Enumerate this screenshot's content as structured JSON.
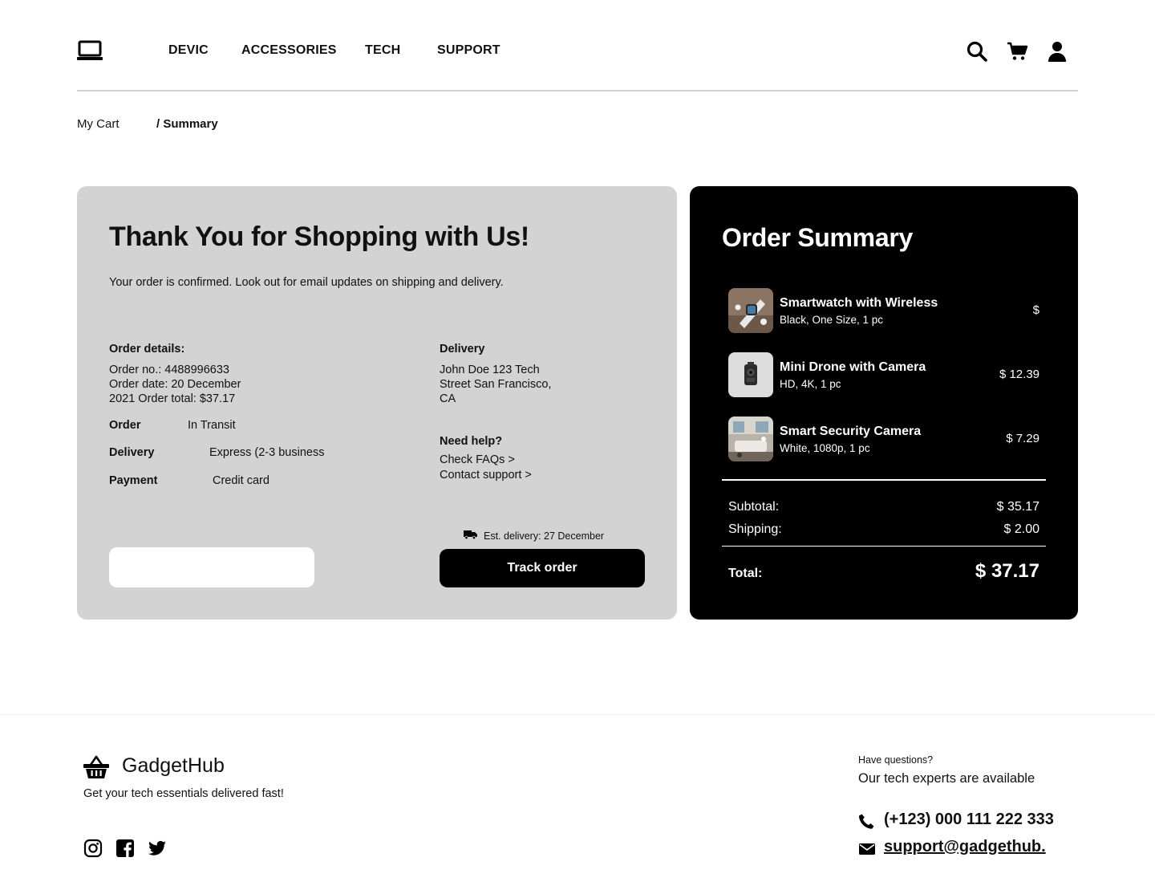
{
  "header": {
    "logo_icon": "laptop-icon",
    "nav": [
      "DEVIC",
      "ACCESSORIES",
      "TECH",
      "SUPPORT"
    ],
    "icons": [
      "search-icon",
      "cart-icon",
      "user-icon"
    ]
  },
  "breadcrumb": {
    "cart": "My Cart",
    "current": "/ Summary"
  },
  "confirmation": {
    "title": "Thank You for Shopping with Us!",
    "subtitle": "Your order is confirmed. Look out for email updates on shipping and delivery.",
    "order_details_label": "Order details:",
    "order_lines": [
      "Order no.: 4488996633",
      "Order date: 20 December",
      "2021 Order total: $37.17"
    ],
    "status_rows": [
      {
        "label": "Order",
        "value": "In Transit"
      },
      {
        "label": "Delivery",
        "value": "Express (2-3 business"
      },
      {
        "label": "Payment",
        "value": "Credit card"
      }
    ],
    "delivery_label": "Delivery",
    "delivery_lines": [
      "John Doe 123 Tech",
      "Street San Francisco,",
      "CA"
    ],
    "help_label": "Need help?",
    "help_links": [
      "Check FAQs >",
      "Contact support >"
    ],
    "est_delivery": "Est. delivery: 27 December",
    "track_button": "Track order",
    "secondary_button": ""
  },
  "summary": {
    "title": "Order Summary",
    "items": [
      {
        "name": "Smartwatch with Wireless",
        "variant": "Black, One Size, 1 pc",
        "price": "$"
      },
      {
        "name": "Mini Drone with Camera",
        "variant": "HD, 4K, 1 pc",
        "price": "$ 12.39"
      },
      {
        "name": "Smart Security Camera",
        "variant": "White, 1080p, 1 pc",
        "price": "$ 7.29"
      }
    ],
    "subtotal_label": "Subtotal:",
    "subtotal": "$ 35.17",
    "shipping_label": "Shipping:",
    "shipping": "$ 2.00",
    "total_label": "Total:",
    "total": "$ 37.17"
  },
  "footer": {
    "brand": "GadgetHub",
    "tagline": "Get your tech essentials delivered fast!",
    "socials": [
      "instagram-icon",
      "facebook-icon",
      "twitter-icon"
    ],
    "questions": "Have questions?",
    "available": "Our tech experts are available",
    "phone": "(+123) 000 111 222 333",
    "email": "support@gadgethub."
  },
  "colors": {
    "panel_light": "#d3d3d3",
    "panel_dark": "#000000",
    "text": "#111111"
  }
}
